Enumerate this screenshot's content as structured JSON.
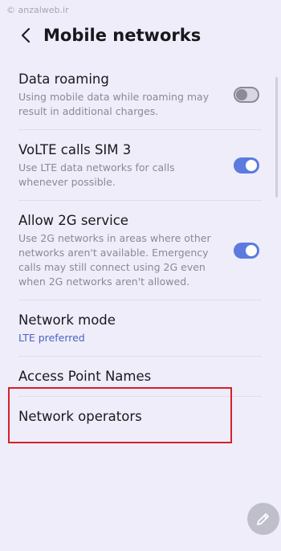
{
  "watermark": "© anzalweb.ir",
  "header": {
    "title": "Mobile networks",
    "back_icon": "chevron-left-icon"
  },
  "settings": [
    {
      "title": "Data roaming",
      "subtitle": "Using mobile data while roaming may result in additional charges.",
      "toggle": "off"
    },
    {
      "title": "VoLTE calls SIM 3",
      "subtitle": "Use LTE data networks for calls whenever possible.",
      "toggle": "on"
    },
    {
      "title": "Allow 2G service",
      "subtitle": "Use 2G networks in areas where other networks aren't available. Emergency calls may still connect using 2G even when 2G networks aren't allowed.",
      "toggle": "on"
    },
    {
      "title": "Network mode",
      "subtitle": "LTE preferred"
    },
    {
      "title": "Access Point Names"
    },
    {
      "title": "Network operators"
    }
  ],
  "colors": {
    "background": "#eeedf9",
    "toggle_on": "#5b7be0",
    "accent_text": "#4a63c7",
    "highlight_box": "#d61f2a"
  },
  "fab_icon": "pencil-icon"
}
